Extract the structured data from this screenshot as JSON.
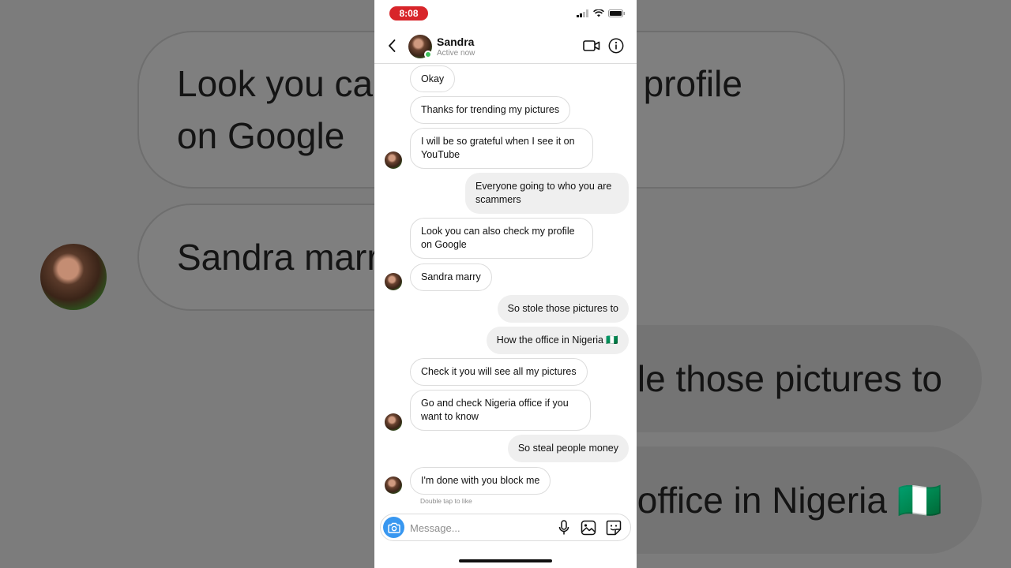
{
  "background": {
    "bubbles": [
      {
        "lines": [
          "Look you can also check my profile",
          "on Google"
        ]
      },
      {
        "text": "Sandra marry"
      },
      {
        "text": "So stole those pictures to"
      },
      {
        "text": "How the office in Nigeria 🇳🇬"
      }
    ]
  },
  "status_bar": {
    "time": "8:08",
    "time_pill_color": "#d8252a"
  },
  "header": {
    "name": "Sandra",
    "status": "Active now",
    "icons": [
      "back-chevron-icon",
      "video-call-icon",
      "info-icon"
    ]
  },
  "messages": [
    {
      "side": "received",
      "text": "Okay"
    },
    {
      "side": "received",
      "text": "Thanks for trending my pictures"
    },
    {
      "side": "received",
      "text": "I will be so grateful when I see it on YouTube"
    },
    {
      "side": "sent",
      "text": "Everyone going to who you are scammers"
    },
    {
      "side": "received",
      "text": "Look you can also check my profile on Google"
    },
    {
      "side": "received",
      "text": "Sandra marry"
    },
    {
      "side": "sent",
      "text": "So stole those pictures to"
    },
    {
      "side": "sent",
      "text": "How the office in Nigeria 🇳🇬"
    },
    {
      "side": "received",
      "text": "Check it you will see all my pictures"
    },
    {
      "side": "received",
      "text": "Go and check Nigeria office if  you want to know"
    },
    {
      "side": "sent",
      "text": "So steal people money"
    },
    {
      "side": "received",
      "text": "I'm done with you block me"
    }
  ],
  "hint": "Double tap to like",
  "composer": {
    "placeholder": "Message...",
    "icons": [
      "camera-icon",
      "microphone-icon",
      "gallery-icon",
      "sticker-icon"
    ]
  },
  "colors": {
    "accent": "#3897f0",
    "online": "#3fc15c",
    "sent_bubble": "#efefef"
  }
}
